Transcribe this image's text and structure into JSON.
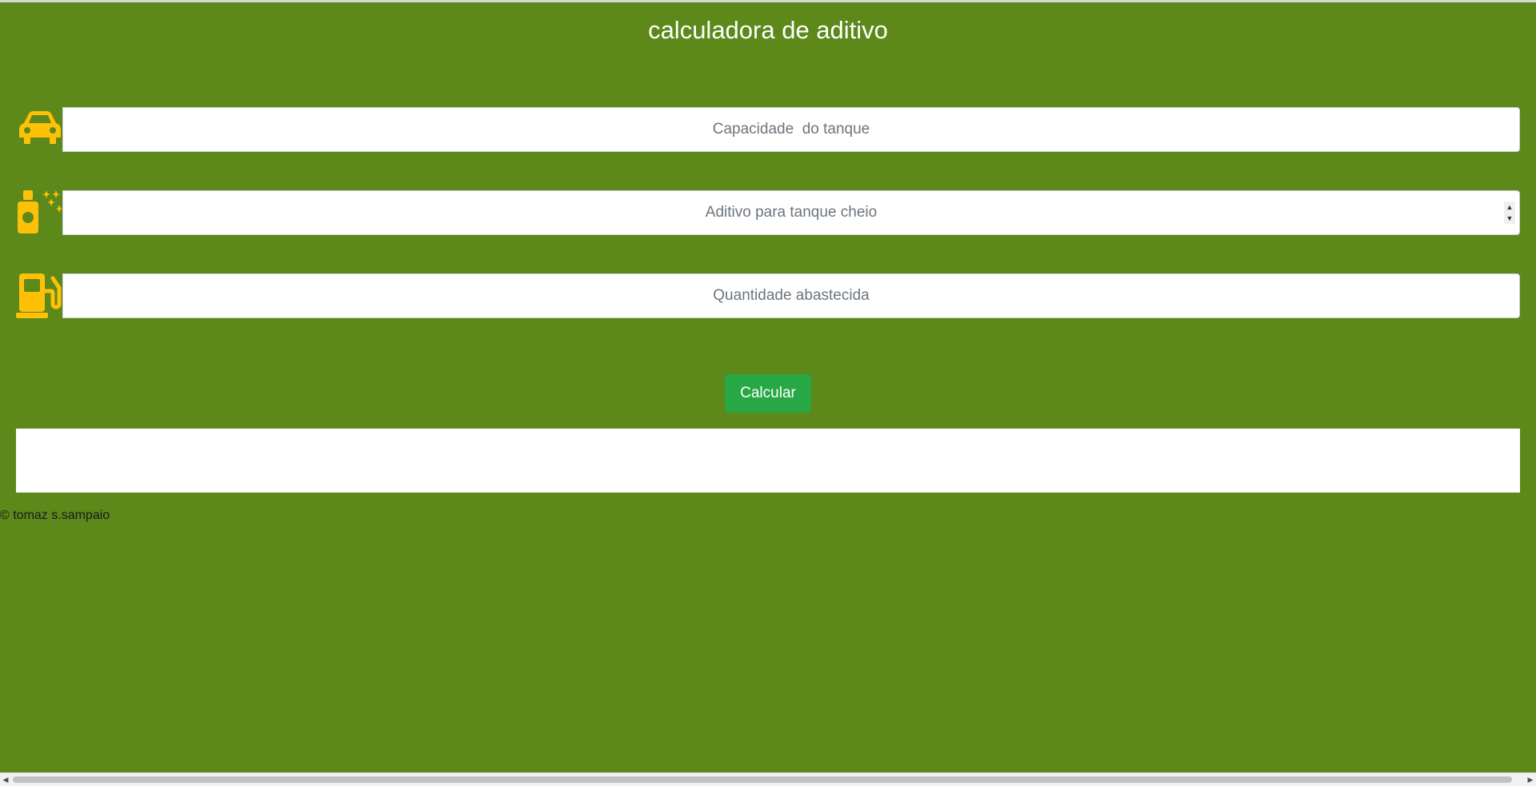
{
  "page": {
    "title": "calculadora de aditivo",
    "background_color": "#5d881a",
    "icon_color": "#ffc107"
  },
  "fields": [
    {
      "icon": "car-icon",
      "placeholder": "Capacidade  do tanque",
      "value": ""
    },
    {
      "icon": "additive-bottle-icon",
      "placeholder": "Aditivo para tanque cheio",
      "value": ""
    },
    {
      "icon": "fuel-pump-icon",
      "placeholder": "Quantidade abastecida",
      "value": ""
    }
  ],
  "actions": {
    "calculate_label": "Calcular",
    "button_color": "#28a745"
  },
  "result": {
    "text": ""
  },
  "footer": {
    "text": "© tomaz s.sampaio"
  }
}
